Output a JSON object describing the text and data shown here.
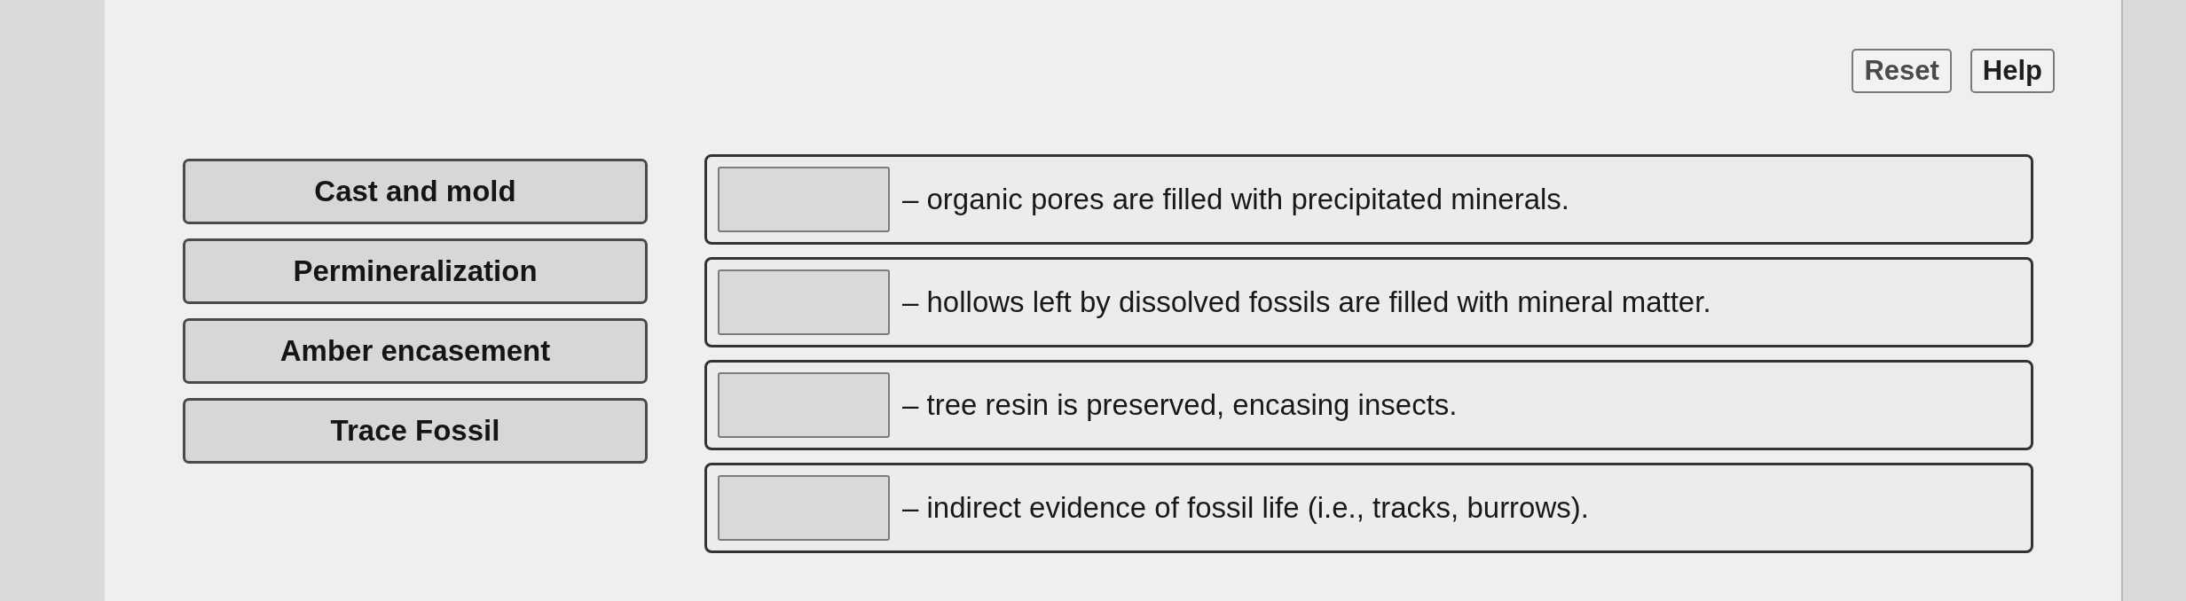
{
  "buttons": [
    {
      "label": "Reset"
    },
    {
      "label": "Help"
    }
  ],
  "choices": [
    {
      "label": "Cast and mold"
    },
    {
      "label": "Permineralization"
    },
    {
      "label": "Amber encasement"
    },
    {
      "label": "Trace Fossil"
    }
  ],
  "statements": [
    {
      "text": "– organic pores are filled with precipitated minerals."
    },
    {
      "text": "– hollows left by dissolved fossils are filled with mineral matter."
    },
    {
      "text": "– tree resin is preserved, encasing insects."
    },
    {
      "text": "– indirect evidence of fossil life (i.e., tracks, burrows)."
    }
  ]
}
